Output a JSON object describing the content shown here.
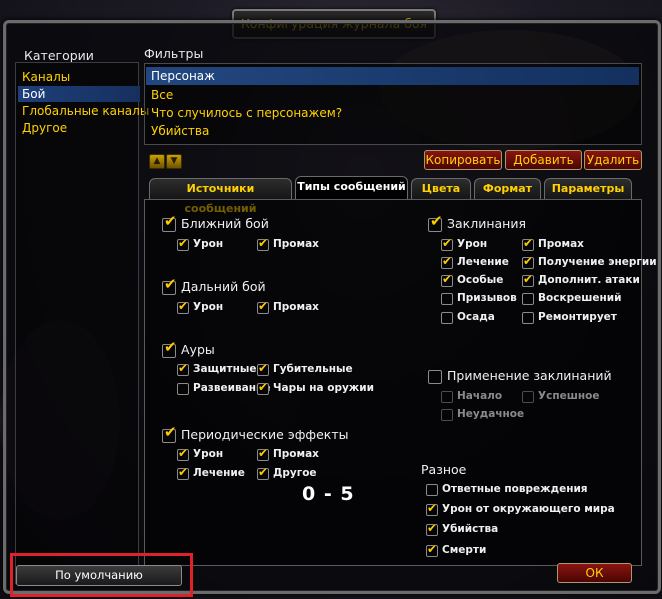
{
  "window_title": "Конфигурация журнала боя",
  "categories": {
    "header": "Категории",
    "items": [
      {
        "label": "Каналы",
        "selected": false
      },
      {
        "label": "Бой",
        "selected": true
      },
      {
        "label": "Глобальные каналы",
        "selected": false
      },
      {
        "label": "Другое",
        "selected": false
      }
    ]
  },
  "filters": {
    "header": "Фильтры",
    "items": [
      {
        "label": "Персонаж",
        "selected": true
      },
      {
        "label": "Все",
        "selected": false
      },
      {
        "label": "Что случилось с персонажем?",
        "selected": false
      },
      {
        "label": "Убийства",
        "selected": false
      }
    ],
    "buttons": {
      "copy": "Копировать",
      "add": "Добавить",
      "delete": "Удалить"
    }
  },
  "tabs": [
    {
      "label": "Источники сообщений",
      "active": false
    },
    {
      "label": "Типы сообщений",
      "active": true
    },
    {
      "label": "Цвета",
      "active": false
    },
    {
      "label": "Формат",
      "active": false
    },
    {
      "label": "Параметры",
      "active": false
    }
  ],
  "melee": {
    "header": "Ближний бой",
    "checked": true,
    "options": [
      {
        "label": "Урон",
        "checked": true
      },
      {
        "label": "Промах",
        "checked": true
      }
    ]
  },
  "ranged": {
    "header": "Дальний бой",
    "checked": true,
    "options": [
      {
        "label": "Урон",
        "checked": true
      },
      {
        "label": "Промах",
        "checked": true
      }
    ]
  },
  "auras": {
    "header": "Ауры",
    "checked": true,
    "options": [
      {
        "label": "Защитные",
        "checked": true
      },
      {
        "label": "Губительные",
        "checked": true
      },
      {
        "label": "Развеивание",
        "checked": false
      },
      {
        "label": "Чары на оружии",
        "checked": true
      }
    ]
  },
  "periodic": {
    "header": "Периодические эффекты",
    "checked": true,
    "options": [
      {
        "label": "Урон",
        "checked": true
      },
      {
        "label": "Промах",
        "checked": true
      },
      {
        "label": "Лечение",
        "checked": true
      },
      {
        "label": "Другое",
        "checked": true
      }
    ]
  },
  "spells": {
    "header": "Заклинания",
    "checked": true,
    "options": [
      {
        "label": "Урон",
        "checked": true
      },
      {
        "label": "Промах",
        "checked": true
      },
      {
        "label": "Лечение",
        "checked": true
      },
      {
        "label": "Получение энергии",
        "checked": true
      },
      {
        "label": "Особые",
        "checked": true
      },
      {
        "label": "Дополнит. атаки",
        "checked": true
      },
      {
        "label": "Призывов",
        "checked": false
      },
      {
        "label": "Воскрешений",
        "checked": false
      },
      {
        "label": "Осада",
        "checked": false
      },
      {
        "label": "Ремонтирует",
        "checked": false
      }
    ]
  },
  "spell_casting": {
    "header": "Применение заклинаний",
    "checked": false,
    "options": [
      {
        "label": "Начало",
        "checked": false
      },
      {
        "label": "Успешное",
        "checked": false
      },
      {
        "label": "Неудачное",
        "checked": false
      }
    ]
  },
  "misc": {
    "header": "Разное",
    "options": [
      {
        "label": "Ответные повреждения",
        "checked": false
      },
      {
        "label": "Урон от окружающего мира",
        "checked": true
      },
      {
        "label": "Убийства",
        "checked": true
      },
      {
        "label": "Смерти",
        "checked": true
      }
    ]
  },
  "overlay_text": "0 - 5",
  "default_button": "По умолчанию",
  "ok_button": "ОК",
  "colors": {
    "accent_gold": "#ffd100",
    "selection_blue": "#224780",
    "button_red": "#8a1410",
    "highlight_red": "#e0202a"
  }
}
